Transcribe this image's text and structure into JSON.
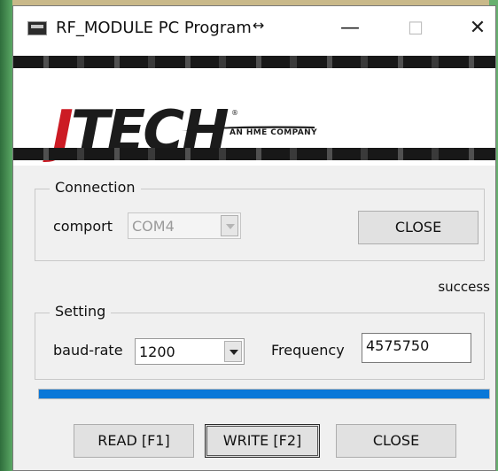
{
  "window": {
    "title": "RF_MODULE PC Program",
    "title_glyph": "↔",
    "minimize_glyph": "—",
    "maximize_glyph": "☐",
    "close_glyph": "✕"
  },
  "banner": {
    "logo_first_letter": "J",
    "logo_rest": "TECH",
    "logo_registered": "®",
    "logo_tagline": "AN HME COMPANY"
  },
  "connection": {
    "group_label": "Connection",
    "comport_label": "comport",
    "comport_value": "COM4",
    "close_button": "CLOSE"
  },
  "status": {
    "text": "success"
  },
  "setting": {
    "group_label": "Setting",
    "baud_label": "baud-rate",
    "baud_value": "1200",
    "frequency_label": "Frequency",
    "frequency_value": "4575750"
  },
  "progress": {
    "percent": 100
  },
  "actions": {
    "read_label": "READ [F1]",
    "write_label": "WRITE [F2]",
    "close_label": "CLOSE"
  },
  "colors": {
    "accent_progress": "#0a78d8",
    "logo_red": "#cc1b24",
    "logo_black": "#1b1b1b"
  }
}
